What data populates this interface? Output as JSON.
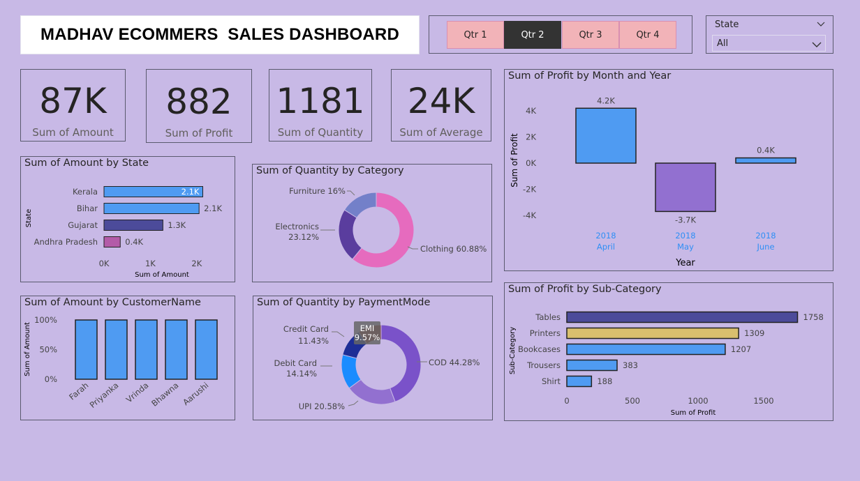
{
  "header": {
    "title": "MADHAV ECOMMERS  SALES DASHBOARD"
  },
  "quarters": [
    {
      "label": "Qtr 1",
      "active": false
    },
    {
      "label": "Qtr 2",
      "active": true
    },
    {
      "label": "Qtr 3",
      "active": false
    },
    {
      "label": "Qtr 4",
      "active": false
    }
  ],
  "state_filter": {
    "label": "State",
    "value": "All"
  },
  "kpis": [
    {
      "value": "87K",
      "label": "Sum of Amount"
    },
    {
      "value": "882",
      "label": "Sum of Profit"
    },
    {
      "value": "1181",
      "label": "Sum of Quantity"
    },
    {
      "value": "24K",
      "label": "Sum of Average"
    }
  ],
  "colors": {
    "background": "#c8b9e6",
    "blue": "#4f9bf2",
    "navy": "#4c4b9a",
    "magenta": "#b35ba8",
    "purple": "#9270d0",
    "pink": "#e66bbe",
    "periwinkle": "#7380c9",
    "gold": "#d9bf6e",
    "royal": "#7a52c9",
    "dark_blue": "#1e2e96",
    "bright_blue": "#1a8cff",
    "brown": "#8b3a3a"
  },
  "chart_data": [
    {
      "id": "amount_by_state",
      "type": "bar",
      "orientation": "horizontal",
      "title": "Sum of Amount by State",
      "xlabel": "Sum of Amount",
      "ylabel": "State",
      "categories": [
        "Kerala",
        "Bihar",
        "Gujarat",
        "Andhra Pradesh"
      ],
      "values": [
        2130,
        2050,
        1270,
        350
      ],
      "value_labels": [
        "2.1K",
        "2.1K",
        "1.3K",
        "0.4K"
      ],
      "bar_colors": [
        "#4f9bf2",
        "#4f9bf2",
        "#4c4b9a",
        "#b35ba8"
      ],
      "xlim": [
        0,
        2800
      ],
      "xticks": [
        {
          "v": 0,
          "label": "0K"
        },
        {
          "v": 1000,
          "label": "1K"
        },
        {
          "v": 2000,
          "label": "2K"
        }
      ]
    },
    {
      "id": "quantity_by_category",
      "type": "pie",
      "donut": true,
      "title": "Sum of Quantity by Category",
      "slices": [
        {
          "name": "Clothing",
          "value": 60.88,
          "label": "Clothing 60.88%",
          "color": "#e66bbe"
        },
        {
          "name": "Electronics",
          "value": 23.12,
          "label": "Electronics 23.12%",
          "color": "#5a3d9e"
        },
        {
          "name": "Furniture",
          "value": 16.0,
          "label": "Furniture 16%",
          "color": "#7380c9"
        }
      ]
    },
    {
      "id": "profit_by_month",
      "type": "bar",
      "title": "Sum of Profit by Month and Year",
      "xlabel": "Year",
      "ylabel": "Sum of Profit",
      "categories": [
        {
          "year": "2018",
          "month": "April"
        },
        {
          "year": "2018",
          "month": "May"
        },
        {
          "year": "2018",
          "month": "June"
        }
      ],
      "values": [
        4200,
        -3700,
        400
      ],
      "value_labels": [
        "4.2K",
        "-3.7K",
        "0.4K"
      ],
      "bar_colors": [
        "#4f9bf2",
        "#9270d0",
        "#4f9bf2"
      ],
      "ylim": [
        -4800,
        5000
      ],
      "yticks": [
        {
          "v": 4000,
          "label": "4K"
        },
        {
          "v": 2000,
          "label": "2K"
        },
        {
          "v": 0,
          "label": "0K"
        },
        {
          "v": -2000,
          "label": "-2K"
        },
        {
          "v": -4000,
          "label": "-4K"
        }
      ]
    },
    {
      "id": "amount_by_customer",
      "type": "bar",
      "title": "Sum of Amount by CustomerName",
      "ylabel": "Sum of Amount",
      "categories": [
        "Farah",
        "Priyanka",
        "Vrinda",
        "Bhawna",
        "Aarushi"
      ],
      "values": [
        100,
        100,
        100,
        100,
        100
      ],
      "ylim": [
        0,
        100
      ],
      "yticks": [
        {
          "v": 100,
          "label": "100%"
        },
        {
          "v": 50,
          "label": "50%"
        },
        {
          "v": 0,
          "label": "0%"
        }
      ]
    },
    {
      "id": "quantity_by_paymentmode",
      "type": "pie",
      "donut": true,
      "title": "Sum of Quantity by PaymentMode",
      "slices": [
        {
          "name": "COD",
          "value": 44.28,
          "label": "COD 44.28%",
          "color": "#7a52c9"
        },
        {
          "name": "UPI",
          "value": 20.58,
          "label": "UPI 20.58%",
          "color": "#9270d0"
        },
        {
          "name": "Debit Card",
          "value": 14.14,
          "label": "Debit Card",
          "pct": "14.14%",
          "color": "#1a8cff"
        },
        {
          "name": "Credit Card",
          "value": 11.43,
          "label": "Credit Card",
          "pct": "11.43%",
          "color": "#1e2e96"
        },
        {
          "name": "EMI",
          "value": 9.57,
          "label": "EMI",
          "pct": "9.57%",
          "color": "#8b3a3a"
        }
      ]
    },
    {
      "id": "profit_by_subcategory",
      "type": "bar",
      "orientation": "horizontal",
      "title": "Sum of Profit by Sub-Category",
      "xlabel": "Sum of Profit",
      "ylabel": "Sub-Category",
      "categories": [
        "Tables",
        "Printers",
        "Bookcases",
        "Trousers",
        "Shirt"
      ],
      "values": [
        1758,
        1309,
        1207,
        383,
        188
      ],
      "bar_colors": [
        "#4c4b9a",
        "#d9bf6e",
        "#4f9bf2",
        "#4f9bf2",
        "#4f9bf2"
      ],
      "xlim": [
        0,
        2000
      ],
      "xticks": [
        {
          "v": 0,
          "label": "0"
        },
        {
          "v": 500,
          "label": "500"
        },
        {
          "v": 1000,
          "label": "1000"
        },
        {
          "v": 1500,
          "label": "1500"
        }
      ]
    }
  ]
}
